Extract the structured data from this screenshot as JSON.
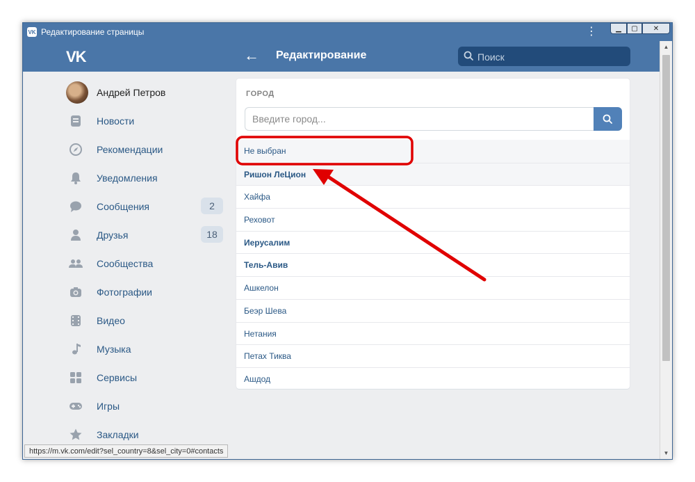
{
  "window": {
    "title": "Редактирование страницы",
    "menu_icon": "three-dots-vertical-icon",
    "buttons": {
      "minimize": "▁",
      "maximize": "▢",
      "close": "✕"
    }
  },
  "header": {
    "logo": "VK",
    "back_icon": "arrow-left-icon",
    "title": "Редактирование",
    "search_placeholder": "Поиск"
  },
  "sidebar": {
    "profile_name": "Андрей Петров",
    "items": [
      {
        "label": "Новости",
        "icon": "news-icon"
      },
      {
        "label": "Рекомендации",
        "icon": "compass-icon"
      },
      {
        "label": "Уведомления",
        "icon": "bell-icon"
      },
      {
        "label": "Сообщения",
        "icon": "chat-icon",
        "badge": "2"
      },
      {
        "label": "Друзья",
        "icon": "person-icon",
        "badge": "18"
      },
      {
        "label": "Сообщества",
        "icon": "group-icon"
      },
      {
        "label": "Фотографии",
        "icon": "camera-icon"
      },
      {
        "label": "Видео",
        "icon": "film-icon"
      },
      {
        "label": "Музыка",
        "icon": "music-note-icon"
      },
      {
        "label": "Сервисы",
        "icon": "services-grid-icon"
      },
      {
        "label": "Игры",
        "icon": "gamepad-icon"
      },
      {
        "label": "Закладки",
        "icon": "star-icon"
      }
    ]
  },
  "city_selector": {
    "heading": "ГОРОД",
    "input_placeholder": "Введите город...",
    "input_value": "",
    "cities": [
      {
        "name": "Не выбран",
        "bold": false
      },
      {
        "name": "Ришон ЛеЦион",
        "bold": true
      },
      {
        "name": "Хайфа",
        "bold": false
      },
      {
        "name": "Реховот",
        "bold": false
      },
      {
        "name": "Иерусалим",
        "bold": true
      },
      {
        "name": "Тель-Авив",
        "bold": true
      },
      {
        "name": "Ашкелон",
        "bold": false
      },
      {
        "name": "Беэр Шева",
        "bold": false
      },
      {
        "name": "Нетания",
        "bold": false
      },
      {
        "name": "Петах Тиква",
        "bold": false
      },
      {
        "name": "Ашдод",
        "bold": false
      }
    ]
  },
  "status_bar": {
    "url": "https://m.vk.com/edit?sel_country=8&sel_city=0#contacts"
  },
  "colors": {
    "brand": "#4a76a8",
    "link": "#2a5885",
    "annotation": "#e00000"
  }
}
